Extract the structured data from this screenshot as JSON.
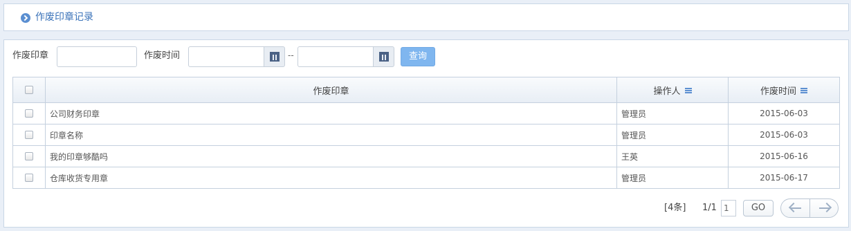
{
  "page_title": "作废印章记录",
  "filter": {
    "seal_label": "作废印章",
    "seal_value": "",
    "time_label": "作废时间",
    "date_from": "",
    "date_separator": "--",
    "date_to": "",
    "query_label": "查询"
  },
  "table": {
    "headers": {
      "seal": "作废印章",
      "operator": "操作人",
      "time": "作废时间"
    },
    "rows": [
      {
        "seal": "公司财务印章",
        "operator": "管理员",
        "time": "2015-06-03"
      },
      {
        "seal": "印章名称",
        "operator": "管理员",
        "time": "2015-06-03"
      },
      {
        "seal": "我的印章够酷吗",
        "operator": "王英",
        "time": "2015-06-16"
      },
      {
        "seal": "仓库收货专用章",
        "operator": "管理员",
        "time": "2015-06-17"
      }
    ]
  },
  "pager": {
    "total": "[4条]",
    "page_info": "1/1",
    "page_input": "1",
    "go_label": "GO"
  },
  "colors": {
    "accent": "#5b8fd1",
    "query_button": "#7fb6ef",
    "border": "#c4d0de"
  },
  "icons": [
    "circle-chevron-right-icon",
    "calendar-icon",
    "column-menu-icon",
    "arrow-left-icon",
    "arrow-right-icon"
  ]
}
